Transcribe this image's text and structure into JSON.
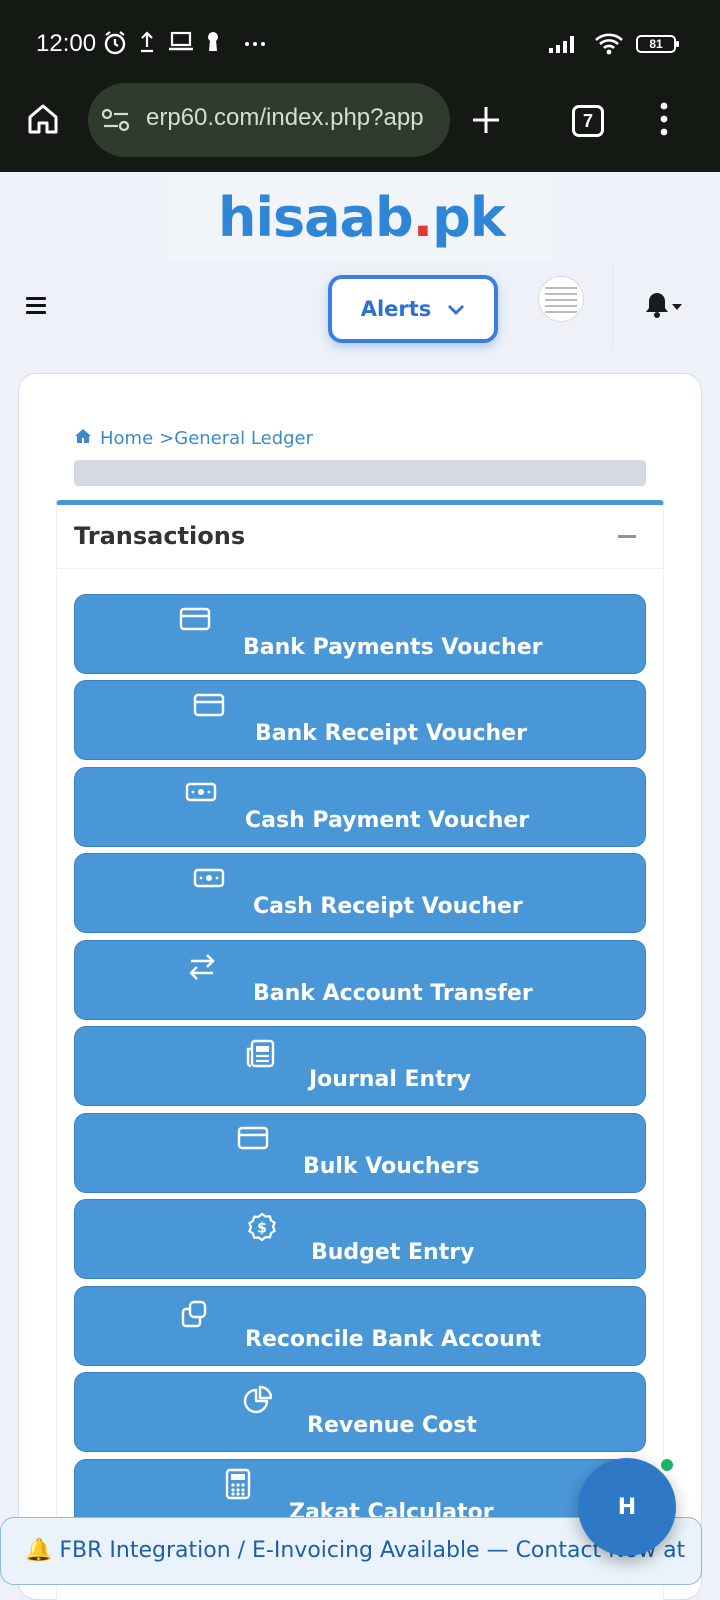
{
  "status_bar": {
    "time": "12:00",
    "battery": "81",
    "icons": [
      "alarm-icon",
      "upload-icon",
      "laptop-icon",
      "keyhole-icon",
      "more-dots-icon",
      "signal-icon",
      "wifi-icon",
      "battery-icon"
    ]
  },
  "browser": {
    "url": "erp60.com/index.php?app",
    "tab_count": "7",
    "icons": [
      "home-icon",
      "site-settings-icon",
      "new-tab-icon",
      "tabs-icon",
      "overflow-menu-icon"
    ]
  },
  "header": {
    "logo_main": "hisaab",
    "logo_dot": ".",
    "logo_tld": "pk",
    "alerts_label": "Alerts"
  },
  "breadcrumb": {
    "home": "Home",
    "separator": ">",
    "current": "General Ledger"
  },
  "panel": {
    "title": "Transactions"
  },
  "transactions": [
    {
      "label": "Bank Payments Voucher",
      "icon": "credit-card-icon"
    },
    {
      "label": "Bank Receipt Voucher",
      "icon": "credit-card-icon"
    },
    {
      "label": "Cash Payment Voucher",
      "icon": "cash-icon"
    },
    {
      "label": "Cash Receipt Voucher",
      "icon": "cash-icon"
    },
    {
      "label": "Bank Account Transfer",
      "icon": "transfer-arrows-icon"
    },
    {
      "label": "Journal Entry",
      "icon": "newspaper-icon"
    },
    {
      "label": "Bulk Vouchers",
      "icon": "credit-card-icon"
    },
    {
      "label": "Budget Entry",
      "icon": "dollar-badge-icon"
    },
    {
      "label": "Reconcile Bank Account",
      "icon": "copy-icon"
    },
    {
      "label": "Revenue Cost",
      "icon": "pie-chart-icon"
    },
    {
      "label": "Zakat Calculator",
      "icon": "calculator-icon"
    }
  ],
  "banner": {
    "text": "🔔 FBR Integration / E-Invoicing Available — Contact Now at"
  },
  "chat": {
    "initial": "H"
  },
  "colors": {
    "accent": "#4a97d8",
    "brand_blue": "#2f86d6",
    "brand_red": "#e23b2e",
    "online": "#1db36a"
  }
}
